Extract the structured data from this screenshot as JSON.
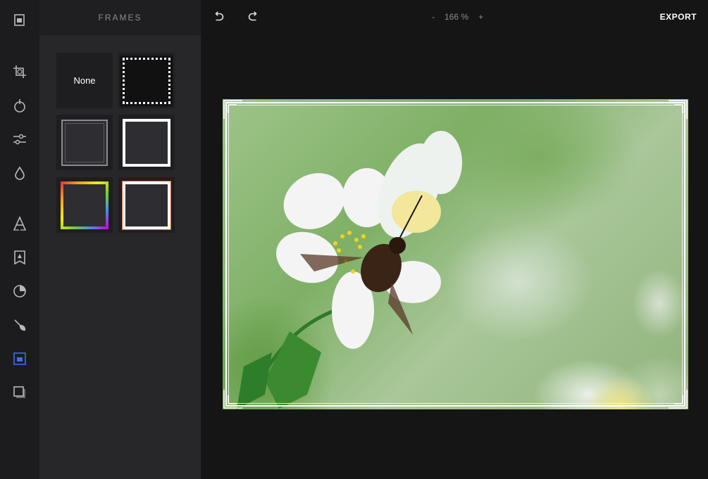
{
  "panel": {
    "title": "FRAMES"
  },
  "frames": {
    "none_label": "None",
    "options": [
      {
        "id": "none"
      },
      {
        "id": "dotted-black"
      },
      {
        "id": "ornate-gray"
      },
      {
        "id": "solid-white"
      },
      {
        "id": "rainbow"
      },
      {
        "id": "orange-white"
      }
    ]
  },
  "topbar": {
    "zoom_minus": "-",
    "zoom_value": "166 %",
    "zoom_plus": "+",
    "export": "EXPORT"
  },
  "tools": [
    "library-icon",
    "crop-icon",
    "filter-icon",
    "adjust-icon",
    "focus-icon",
    "text-icon",
    "sticker-icon",
    "overlay-icon",
    "brush-icon",
    "frame-icon",
    "shape-icon"
  ],
  "colors": {
    "accent": "#3d6cf5",
    "rainbow": [
      "#e83e3e",
      "#f5a623",
      "#f8e71c",
      "#7ed321",
      "#4a90e2",
      "#bd10e0"
    ],
    "orange": "#e0552a"
  }
}
